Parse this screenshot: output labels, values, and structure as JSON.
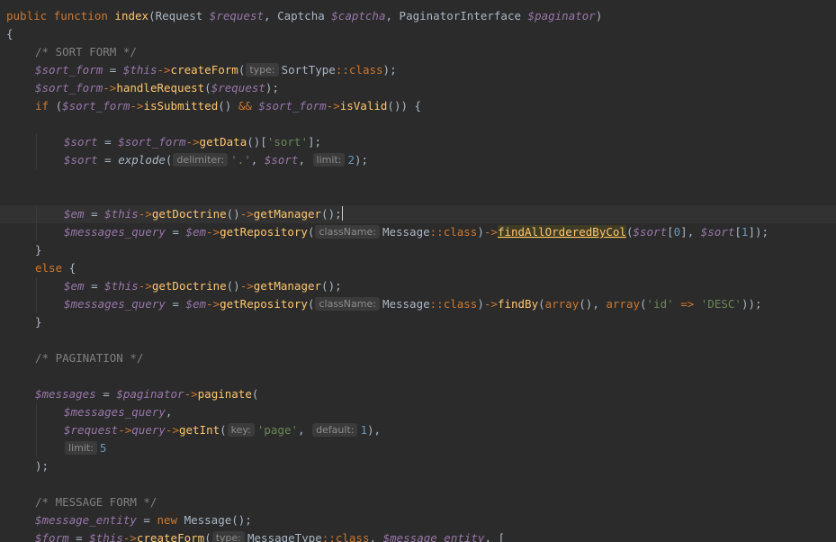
{
  "editor": {
    "lines": [
      {
        "indent": 0,
        "tokens": [
          {
            "t": "kw",
            "v": "public function "
          },
          {
            "t": "fn",
            "v": "index"
          },
          {
            "t": "plain",
            "v": "(Request "
          },
          {
            "t": "var",
            "v": "$request"
          },
          {
            "t": "plain",
            "v": ", Captcha "
          },
          {
            "t": "var",
            "v": "$captcha"
          },
          {
            "t": "plain",
            "v": ", PaginatorInterface "
          },
          {
            "t": "var",
            "v": "$paginator"
          },
          {
            "t": "plain",
            "v": ")"
          }
        ]
      },
      {
        "indent": 0,
        "tokens": [
          {
            "t": "plain",
            "v": "{"
          }
        ]
      },
      {
        "indent": 1,
        "tokens": [
          {
            "t": "com",
            "v": "/* SORT FORM */"
          }
        ]
      },
      {
        "indent": 1,
        "tokens": [
          {
            "t": "var",
            "v": "$sort_form"
          },
          {
            "t": "plain",
            "v": " = "
          },
          {
            "t": "var",
            "v": "$this"
          },
          {
            "t": "op",
            "v": "->"
          },
          {
            "t": "fn",
            "v": "createForm"
          },
          {
            "t": "plain",
            "v": "("
          },
          {
            "t": "hint",
            "v": "type:"
          },
          {
            "t": "plain",
            "v": "SortType"
          },
          {
            "t": "op",
            "v": "::"
          },
          {
            "t": "kw",
            "v": "class"
          },
          {
            "t": "plain",
            "v": ");"
          }
        ]
      },
      {
        "indent": 1,
        "tokens": [
          {
            "t": "var",
            "v": "$sort_form"
          },
          {
            "t": "op",
            "v": "->"
          },
          {
            "t": "fn",
            "v": "handleRequest"
          },
          {
            "t": "plain",
            "v": "("
          },
          {
            "t": "var",
            "v": "$request"
          },
          {
            "t": "plain",
            "v": ");"
          }
        ]
      },
      {
        "indent": 1,
        "tokens": [
          {
            "t": "kw",
            "v": "if "
          },
          {
            "t": "plain",
            "v": "("
          },
          {
            "t": "var",
            "v": "$sort_form"
          },
          {
            "t": "op",
            "v": "->"
          },
          {
            "t": "fn",
            "v": "isSubmitted"
          },
          {
            "t": "plain",
            "v": "() "
          },
          {
            "t": "op",
            "v": "&&"
          },
          {
            "t": "plain",
            "v": " "
          },
          {
            "t": "var",
            "v": "$sort_form"
          },
          {
            "t": "op",
            "v": "->"
          },
          {
            "t": "fn",
            "v": "isValid"
          },
          {
            "t": "plain",
            "v": "()) {"
          }
        ]
      },
      {
        "indent": 0,
        "tokens": []
      },
      {
        "indent": 2,
        "tokens": [
          {
            "t": "var",
            "v": "$sort"
          },
          {
            "t": "plain",
            "v": " = "
          },
          {
            "t": "var",
            "v": "$sort_form"
          },
          {
            "t": "op",
            "v": "->"
          },
          {
            "t": "fn",
            "v": "getData"
          },
          {
            "t": "plain",
            "v": "()["
          },
          {
            "t": "str",
            "v": "'sort'"
          },
          {
            "t": "plain",
            "v": "];"
          }
        ]
      },
      {
        "indent": 2,
        "tokens": [
          {
            "t": "var",
            "v": "$sort"
          },
          {
            "t": "plain",
            "v": " = "
          },
          {
            "t": "italic-fn",
            "v": "explode"
          },
          {
            "t": "plain",
            "v": "("
          },
          {
            "t": "hint",
            "v": "delimiter:"
          },
          {
            "t": "str",
            "v": "'.'"
          },
          {
            "t": "plain",
            "v": ", "
          },
          {
            "t": "var",
            "v": "$sort"
          },
          {
            "t": "plain",
            "v": ", "
          },
          {
            "t": "hint",
            "v": "limit:"
          },
          {
            "t": "num",
            "v": "2"
          },
          {
            "t": "plain",
            "v": ");"
          }
        ]
      },
      {
        "indent": 0,
        "tokens": []
      },
      {
        "indent": 0,
        "tokens": []
      },
      {
        "indent": 2,
        "current": true,
        "tokens": [
          {
            "t": "var",
            "v": "$em"
          },
          {
            "t": "plain",
            "v": " = "
          },
          {
            "t": "var",
            "v": "$this"
          },
          {
            "t": "op",
            "v": "->"
          },
          {
            "t": "fn",
            "v": "getDoctrine"
          },
          {
            "t": "plain",
            "v": "()"
          },
          {
            "t": "op",
            "v": "->"
          },
          {
            "t": "fn",
            "v": "getManager"
          },
          {
            "t": "plain",
            "v": "();"
          },
          {
            "t": "caret",
            "v": ""
          }
        ]
      },
      {
        "indent": 2,
        "tokens": [
          {
            "t": "var",
            "v": "$messages_query"
          },
          {
            "t": "plain",
            "v": " = "
          },
          {
            "t": "var",
            "v": "$em"
          },
          {
            "t": "op",
            "v": "->"
          },
          {
            "t": "fn",
            "v": "getRepository"
          },
          {
            "t": "plain",
            "v": "("
          },
          {
            "t": "hint",
            "v": "className:"
          },
          {
            "t": "plain",
            "v": "Message"
          },
          {
            "t": "op",
            "v": "::"
          },
          {
            "t": "kw",
            "v": "class"
          },
          {
            "t": "plain",
            "v": ")"
          },
          {
            "t": "op",
            "v": "->"
          },
          {
            "t": "hl",
            "v": "findAllOrderedByCol"
          },
          {
            "t": "plain",
            "v": "("
          },
          {
            "t": "var",
            "v": "$sort"
          },
          {
            "t": "plain",
            "v": "["
          },
          {
            "t": "num",
            "v": "0"
          },
          {
            "t": "plain",
            "v": "], "
          },
          {
            "t": "var",
            "v": "$sort"
          },
          {
            "t": "plain",
            "v": "["
          },
          {
            "t": "num",
            "v": "1"
          },
          {
            "t": "plain",
            "v": "]);"
          }
        ]
      },
      {
        "indent": 1,
        "tokens": [
          {
            "t": "plain",
            "v": "}"
          }
        ]
      },
      {
        "indent": 1,
        "tokens": [
          {
            "t": "kw",
            "v": "else "
          },
          {
            "t": "plain",
            "v": "{"
          }
        ]
      },
      {
        "indent": 2,
        "tokens": [
          {
            "t": "var",
            "v": "$em"
          },
          {
            "t": "plain",
            "v": " = "
          },
          {
            "t": "var",
            "v": "$this"
          },
          {
            "t": "op",
            "v": "->"
          },
          {
            "t": "fn",
            "v": "getDoctrine"
          },
          {
            "t": "plain",
            "v": "()"
          },
          {
            "t": "op",
            "v": "->"
          },
          {
            "t": "fn",
            "v": "getManager"
          },
          {
            "t": "plain",
            "v": "();"
          }
        ]
      },
      {
        "indent": 2,
        "tokens": [
          {
            "t": "var",
            "v": "$messages_query"
          },
          {
            "t": "plain",
            "v": " = "
          },
          {
            "t": "var",
            "v": "$em"
          },
          {
            "t": "op",
            "v": "->"
          },
          {
            "t": "fn",
            "v": "getRepository"
          },
          {
            "t": "plain",
            "v": "("
          },
          {
            "t": "hint",
            "v": "className:"
          },
          {
            "t": "plain",
            "v": "Message"
          },
          {
            "t": "op",
            "v": "::"
          },
          {
            "t": "kw",
            "v": "class"
          },
          {
            "t": "plain",
            "v": ")"
          },
          {
            "t": "op",
            "v": "->"
          },
          {
            "t": "fn",
            "v": "findBy"
          },
          {
            "t": "plain",
            "v": "("
          },
          {
            "t": "kw",
            "v": "array"
          },
          {
            "t": "plain",
            "v": "(), "
          },
          {
            "t": "kw",
            "v": "array"
          },
          {
            "t": "plain",
            "v": "("
          },
          {
            "t": "str",
            "v": "'id'"
          },
          {
            "t": "plain",
            "v": " "
          },
          {
            "t": "op",
            "v": "=>"
          },
          {
            "t": "plain",
            "v": " "
          },
          {
            "t": "str",
            "v": "'DESC'"
          },
          {
            "t": "plain",
            "v": "));"
          }
        ]
      },
      {
        "indent": 1,
        "tokens": [
          {
            "t": "plain",
            "v": "}"
          }
        ]
      },
      {
        "indent": 0,
        "tokens": []
      },
      {
        "indent": 1,
        "tokens": [
          {
            "t": "com",
            "v": "/* PAGINATION */"
          }
        ]
      },
      {
        "indent": 0,
        "tokens": []
      },
      {
        "indent": 1,
        "tokens": [
          {
            "t": "var",
            "v": "$messages"
          },
          {
            "t": "plain",
            "v": " = "
          },
          {
            "t": "var",
            "v": "$paginator"
          },
          {
            "t": "op",
            "v": "->"
          },
          {
            "t": "fn",
            "v": "paginate"
          },
          {
            "t": "plain",
            "v": "("
          }
        ]
      },
      {
        "indent": 2,
        "tokens": [
          {
            "t": "var",
            "v": "$messages_query"
          },
          {
            "t": "plain",
            "v": ","
          }
        ]
      },
      {
        "indent": 2,
        "tokens": [
          {
            "t": "var",
            "v": "$request"
          },
          {
            "t": "op",
            "v": "->"
          },
          {
            "t": "var",
            "v": "query"
          },
          {
            "t": "op",
            "v": "->"
          },
          {
            "t": "fn",
            "v": "getInt"
          },
          {
            "t": "plain",
            "v": "("
          },
          {
            "t": "hint",
            "v": "key:"
          },
          {
            "t": "str",
            "v": "'page'"
          },
          {
            "t": "plain",
            "v": ", "
          },
          {
            "t": "hint",
            "v": "default:"
          },
          {
            "t": "num",
            "v": "1"
          },
          {
            "t": "plain",
            "v": "),"
          }
        ]
      },
      {
        "indent": 2,
        "tokens": [
          {
            "t": "hint",
            "v": "limit:"
          },
          {
            "t": "num",
            "v": "5"
          }
        ]
      },
      {
        "indent": 1,
        "tokens": [
          {
            "t": "plain",
            "v": ");"
          }
        ]
      },
      {
        "indent": 0,
        "tokens": []
      },
      {
        "indent": 1,
        "tokens": [
          {
            "t": "com",
            "v": "/* MESSAGE FORM */"
          }
        ]
      },
      {
        "indent": 1,
        "tokens": [
          {
            "t": "var",
            "v": "$message_entity"
          },
          {
            "t": "plain",
            "v": " = "
          },
          {
            "t": "kw",
            "v": "new "
          },
          {
            "t": "plain",
            "v": "Message();"
          }
        ]
      },
      {
        "indent": 1,
        "tokens": [
          {
            "t": "var",
            "v": "$form"
          },
          {
            "t": "plain",
            "v": " = "
          },
          {
            "t": "var",
            "v": "$this"
          },
          {
            "t": "op",
            "v": "->"
          },
          {
            "t": "fn",
            "v": "createForm"
          },
          {
            "t": "plain",
            "v": "("
          },
          {
            "t": "hint",
            "v": "type:"
          },
          {
            "t": "plain",
            "v": "MessageType"
          },
          {
            "t": "op",
            "v": "::"
          },
          {
            "t": "kw",
            "v": "class"
          },
          {
            "t": "plain",
            "v": ", "
          },
          {
            "t": "var",
            "v": "$message_entity"
          },
          {
            "t": "plain",
            "v": ", ["
          }
        ]
      }
    ]
  },
  "colors": {
    "background": "#2b2b2b",
    "current_line": "#323232",
    "keyword": "#cc7832",
    "function": "#ffc66d",
    "variable": "#9876aa",
    "string": "#6a8759",
    "number": "#6897bb",
    "comment": "#808080",
    "text": "#a9b7c6"
  }
}
